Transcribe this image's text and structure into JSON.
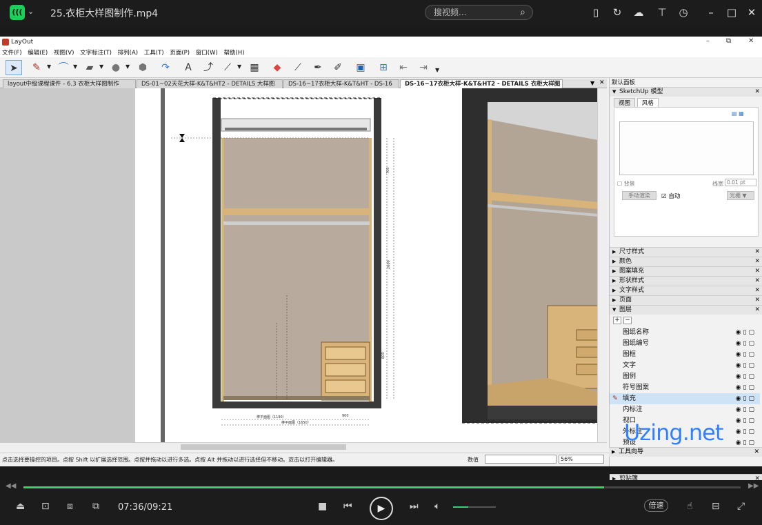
{
  "player": {
    "logo": "(((",
    "title": "25.衣柜大样图制作.mp4",
    "search_placeholder": "搜视频...",
    "time": "07:36/09:21",
    "progress": 0.81,
    "volume": 0.35,
    "speed_label": "倍速"
  },
  "app": {
    "title": "LayOut",
    "menu": [
      "文件(F)",
      "编辑(E)",
      "视图(V)",
      "文字标注(T)",
      "排列(A)",
      "工具(T)",
      "页面(P)",
      "窗口(W)",
      "帮助(H)"
    ],
    "tabs": [
      "layout中级课程课件 - 6.3  衣柜大样图制作",
      "DS-01~02天花大样-K&T&HT2 - DETAILS  大样图",
      "DS-16~17衣柜大样-K&T&HT - DS-16",
      "DS-16~17衣柜大样-K&T&HT2 - DETAILS  衣柜大样图"
    ],
    "status": "点击选择要操控的项目。点按 Shift 以扩展选择范围。点按并拖动以进行多选。点按 Alt 并拖动以进行选择但不移动。双击以打开编辑器。",
    "value_label": "数值",
    "zoom": "56%"
  },
  "drawing": {
    "dims_left": [
      "700",
      "600",
      "2600",
      "900"
    ],
    "dims_bottom_1": "棒平面图（1190）",
    "dims_bottom_2": "棒平面图（1650）",
    "dim_900": "900"
  },
  "panel": {
    "title": "默认面板",
    "sketchup_tray": "SketchUp 模型",
    "sk_tabs": [
      "视图",
      "风格"
    ],
    "background_label": "背景",
    "line_width_label": "线宽",
    "line_width_value": "0.01 pt",
    "render_button": "手动渲染",
    "auto_label": "自动",
    "raster_label": "光栅",
    "trays": [
      "尺寸样式",
      "颜色",
      "图案填充",
      "形状样式",
      "文字样式",
      "页面",
      "图层"
    ],
    "layers": [
      "图纸名称",
      "图纸编号",
      "图框",
      "文字",
      "图例",
      "符号图案",
      "填充",
      "内标注",
      "视口",
      "外标注",
      "预设"
    ],
    "active_layer": "填充",
    "bottom_trays": [
      "剪贴簿",
      "工具向导"
    ],
    "add_btn": "+",
    "remove_btn": "−"
  },
  "watermark": "Uzing.net",
  "colors": {
    "accent": "#3bd16f",
    "wall_fill": "#b8aa9c",
    "cabinet_wood": "#d9b47a",
    "dark_frame": "#3a3a3a"
  }
}
